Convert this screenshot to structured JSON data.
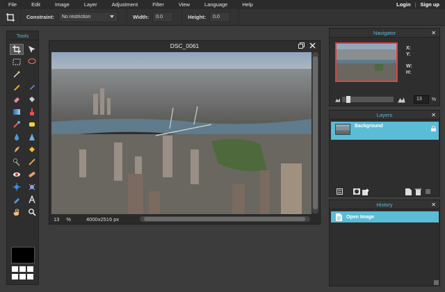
{
  "menu": {
    "items": [
      "File",
      "Edit",
      "Image",
      "Layer",
      "Adjustment",
      "Filter",
      "View",
      "Language",
      "Help"
    ],
    "login": "Login",
    "separator": "|",
    "signup": "Sign up"
  },
  "options": {
    "constraint_label": "Constraint:",
    "constraint_value": "No restriction",
    "width_label": "Width:",
    "width_value": "0.0",
    "height_label": "Height:",
    "height_value": "0.0"
  },
  "tools": {
    "title": "Tools",
    "primary_color": "#000000"
  },
  "document": {
    "title": "DSC_0061",
    "zoom": "13",
    "zoom_unit": "%",
    "dimensions": "4000x2516 px"
  },
  "navigator": {
    "title": "Navigator",
    "x_label": "X:",
    "y_label": "Y:",
    "w_label": "W:",
    "h_label": "H:",
    "zoom_value": "13",
    "zoom_unit": "%"
  },
  "layers": {
    "title": "Layers",
    "items": [
      {
        "name": "Background",
        "locked": true
      }
    ]
  },
  "history": {
    "title": "History",
    "items": [
      {
        "label": "Open Image"
      }
    ]
  },
  "colors": {
    "accent": "#5bbcd6",
    "panel_title": "#5fb7d6",
    "nav_frame": "#e04040"
  }
}
